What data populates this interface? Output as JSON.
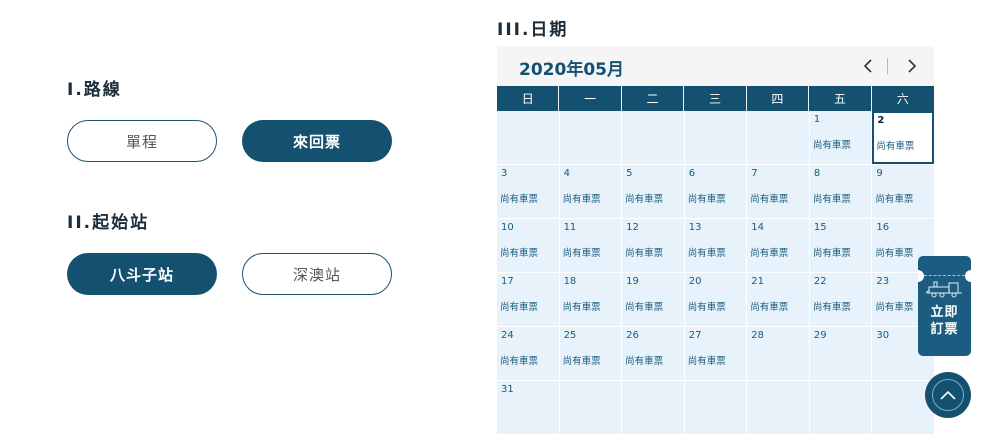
{
  "route": {
    "title": "I.路線",
    "options": [
      {
        "label": "單程",
        "selected": false
      },
      {
        "label": "來回票",
        "selected": true
      }
    ]
  },
  "origin": {
    "title": "II.起始站",
    "options": [
      {
        "label": "八斗子站",
        "selected": true
      },
      {
        "label": "深澳站",
        "selected": false
      }
    ]
  },
  "date": {
    "title": "III.日期",
    "calendar": {
      "month_label": "2020年05月",
      "weekdays": [
        "日",
        "一",
        "二",
        "三",
        "四",
        "五",
        "六"
      ],
      "status_available": "尚有車票",
      "selected_day": "2",
      "weeks": [
        [
          null,
          null,
          null,
          null,
          null,
          {
            "day": "1",
            "status": "尚有車票"
          },
          {
            "day": "2",
            "status": "尚有車票"
          }
        ],
        [
          {
            "day": "3",
            "status": "尚有車票"
          },
          {
            "day": "4",
            "status": "尚有車票"
          },
          {
            "day": "5",
            "status": "尚有車票"
          },
          {
            "day": "6",
            "status": "尚有車票"
          },
          {
            "day": "7",
            "status": "尚有車票"
          },
          {
            "day": "8",
            "status": "尚有車票"
          },
          {
            "day": "9",
            "status": "尚有車票"
          }
        ],
        [
          {
            "day": "10",
            "status": "尚有車票"
          },
          {
            "day": "11",
            "status": "尚有車票"
          },
          {
            "day": "12",
            "status": "尚有車票"
          },
          {
            "day": "13",
            "status": "尚有車票"
          },
          {
            "day": "14",
            "status": "尚有車票"
          },
          {
            "day": "15",
            "status": "尚有車票"
          },
          {
            "day": "16",
            "status": "尚有車票"
          }
        ],
        [
          {
            "day": "17",
            "status": "尚有車票"
          },
          {
            "day": "18",
            "status": "尚有車票"
          },
          {
            "day": "19",
            "status": "尚有車票"
          },
          {
            "day": "20",
            "status": "尚有車票"
          },
          {
            "day": "21",
            "status": "尚有車票"
          },
          {
            "day": "22",
            "status": "尚有車票"
          },
          {
            "day": "23",
            "status": "尚有車票"
          }
        ],
        [
          {
            "day": "24",
            "status": "尚有車票"
          },
          {
            "day": "25",
            "status": "尚有車票"
          },
          {
            "day": "26",
            "status": "尚有車票"
          },
          {
            "day": "27",
            "status": "尚有車票"
          },
          {
            "day": "28",
            "status": ""
          },
          {
            "day": "29",
            "status": ""
          },
          {
            "day": "30",
            "status": ""
          }
        ],
        [
          {
            "day": "31",
            "status": ""
          },
          null,
          null,
          null,
          null,
          null,
          null
        ]
      ]
    }
  },
  "floating": {
    "book_label_line1": "立即",
    "book_label_line2": "訂票",
    "book_icon": "train-icon",
    "top_icon": "chevron-up-icon"
  },
  "colors": {
    "primary": "#14506f",
    "cell_bg": "#e7f2fa",
    "header_bg": "#f5f5f5"
  }
}
